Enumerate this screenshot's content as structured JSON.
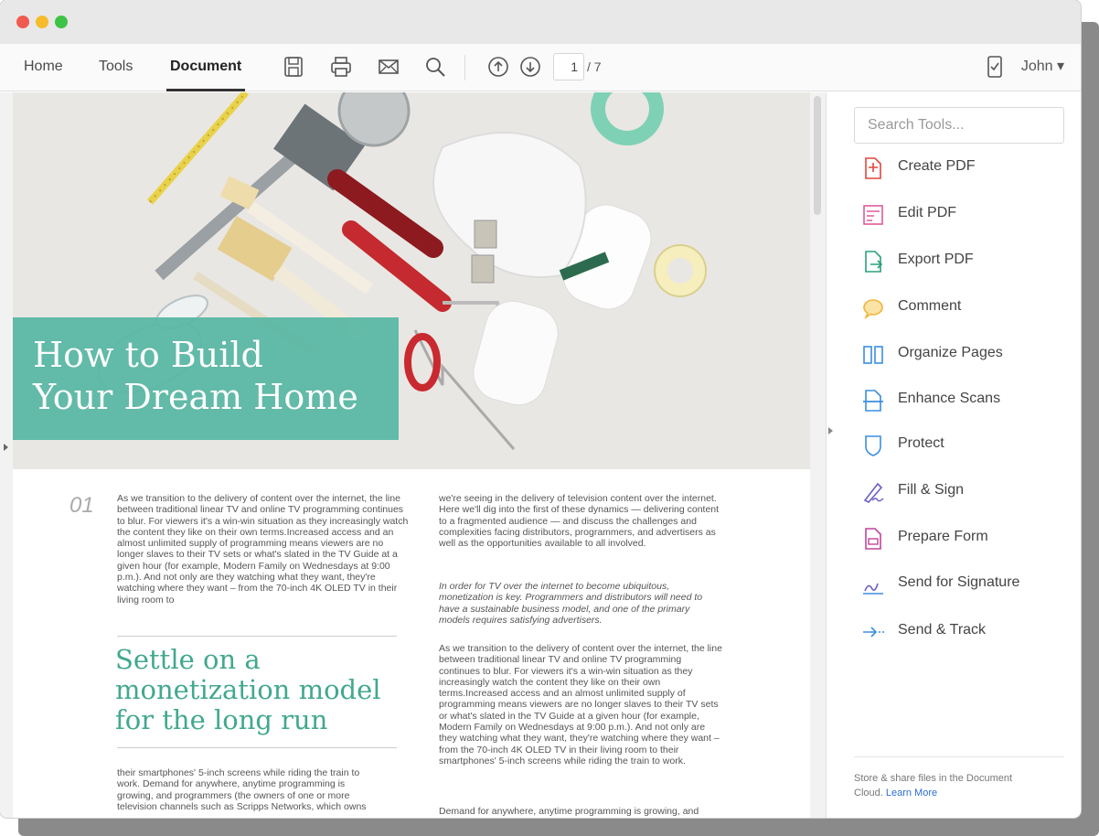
{
  "toolbar": {
    "tabs": [
      "Home",
      "Tools",
      "Document"
    ],
    "active_tab": "Document",
    "page_current": "1",
    "page_total": "/ 7",
    "user_name": "John ▾"
  },
  "document": {
    "hero_title": [
      "How to Build",
      "Your Dream Home"
    ],
    "section_number": "01",
    "col1_intro": "As we transition to the delivery of content over the internet, the line between traditional linear TV and online TV programming continues to blur. For viewers it's a win-win situation as they increasingly watch the content they like on their own terms.Increased access and an almost unlimited supply of programming means viewers are no longer slaves to their TV sets or what's slated in the TV Guide at a given hour (for example, Modern Family on Wednesdays at 9:00 p.m.). And not only are they watching what they want, they're watching where they want – from the 70-inch 4K OLED TV in their living room to",
    "subhead": "Settle on a monetization model for the long run",
    "col1_after": "their smartphones' 5-inch screens while riding the train to work. Demand for anywhere, anytime programming is growing, and programmers (the owners of one or more television channels such as Scripps Networks, which owns",
    "col2_p1": "we're seeing in the delivery of television content over the internet. Here we'll dig into the first of these dynamics — delivering content to a fragmented audience — and discuss the challenges and complexities facing distributors, programmers, and advertisers as well as the opportunities available to all involved.",
    "col2_p2": "In order for TV over the internet to become ubiquitous, monetization is key. Programmers and distributors will need to have a sustainable business model, and one of the primary models requires satisfying advertisers.",
    "col2_p3": "As we transition to the delivery of content over the internet, the line between traditional linear TV and online TV programming continues to blur. For viewers it's a win-win situation as they increasingly watch the content they like on their own terms.Increased access and an almost unlimited supply of programming means viewers are no longer slaves to their TV sets or what's slated in the TV Guide at a given hour (for example, Modern Family on Wednesdays at 9:00 p.m.). And not only are they watching what they want, they're watching where they want – from the 70-inch 4K OLED TV in their living room to their smartphones' 5-inch screens while riding the train to work.",
    "col2_p4": "Demand for anywhere, anytime programming is growing, and"
  },
  "sidebar": {
    "search_placeholder": "Search Tools...",
    "tools": [
      {
        "label": "Create PDF",
        "icon": "create-pdf-icon",
        "color": "#e0473c"
      },
      {
        "label": "Edit PDF",
        "icon": "edit-pdf-icon",
        "color": "#e05b9a"
      },
      {
        "label": "Export PDF",
        "icon": "export-pdf-icon",
        "color": "#2aa07c"
      },
      {
        "label": "Comment",
        "icon": "comment-icon",
        "color": "#f0b53d"
      },
      {
        "label": "Organize Pages",
        "icon": "organize-pages-icon",
        "color": "#3b8ee0"
      },
      {
        "label": "Enhance Scans",
        "icon": "enhance-scans-icon",
        "color": "#3b8ee0"
      },
      {
        "label": "Protect",
        "icon": "protect-icon",
        "color": "#3b8ee0"
      },
      {
        "label": "Fill & Sign",
        "icon": "fill-sign-icon",
        "color": "#6c5fc7"
      },
      {
        "label": "Prepare Form",
        "icon": "prepare-form-icon",
        "color": "#c0459b"
      },
      {
        "label": "Send for Signature",
        "icon": "send-signature-icon",
        "color": "#6c5fc7"
      },
      {
        "label": "Send & Track",
        "icon": "send-track-icon",
        "color": "#3b8ee0"
      }
    ],
    "footer_text": "Store & share files in the Document Cloud.",
    "footer_link": "Learn More"
  }
}
